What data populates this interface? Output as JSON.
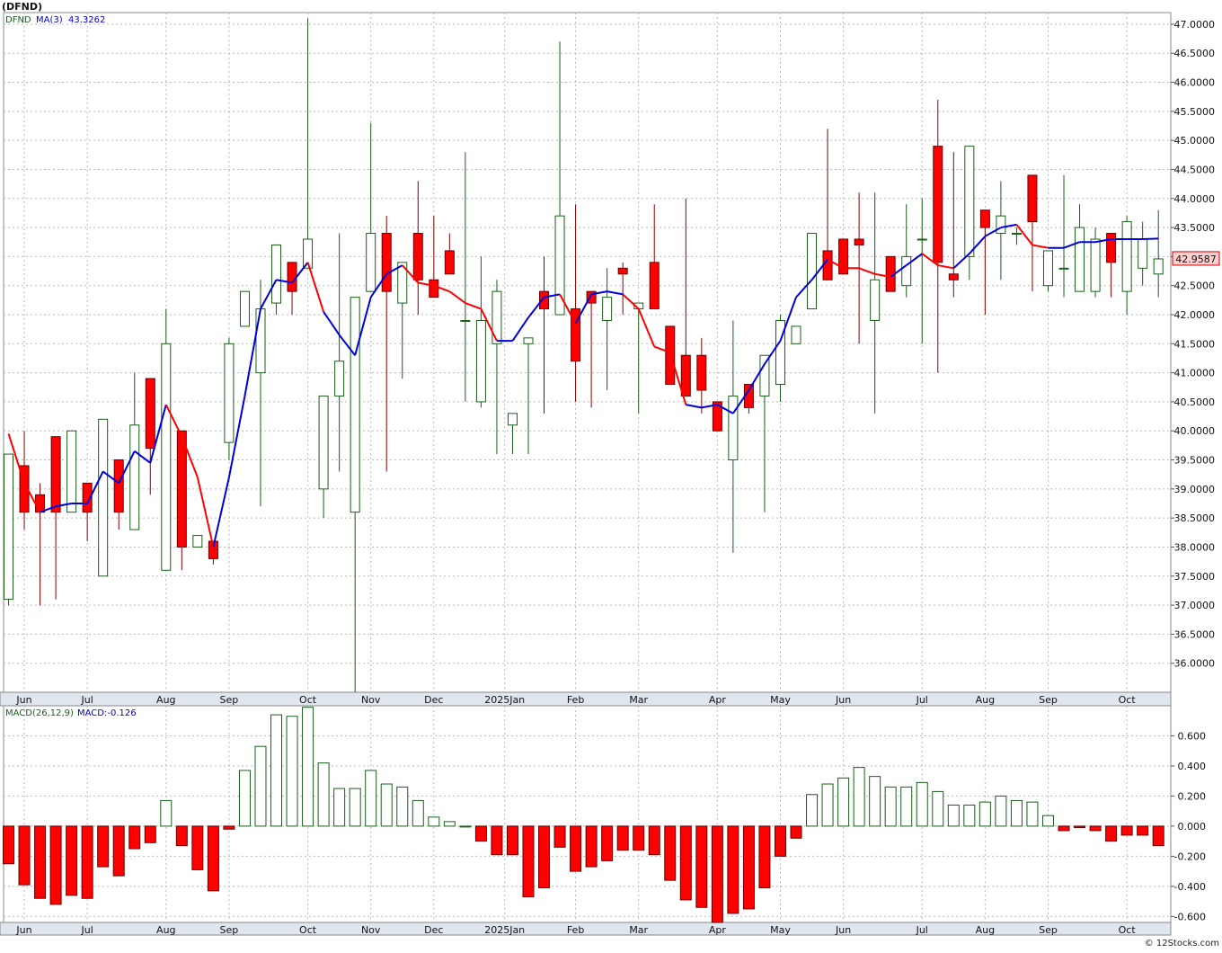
{
  "header": {
    "symbol_label": "(DFND)"
  },
  "watermark": "© 12Stocks.com",
  "colors": {
    "up": "#1a5e1a",
    "down": "#ff0000",
    "ma_up": "#0000dd",
    "ma_down": "#ff0000",
    "grid": "#bbbbbb",
    "axis_band": "#dfe6ee"
  },
  "chart_data": [
    {
      "type": "candlestick",
      "legend": {
        "ticker": "DFND",
        "ma_label": "MA(3)",
        "ma_value": "43.3262"
      },
      "last_price_label": "42.9587",
      "ylim": [
        35.5,
        47.2
      ],
      "y_ticks": [
        36.0,
        36.5,
        37.0,
        37.5,
        38.0,
        38.5,
        39.0,
        39.5,
        40.0,
        40.5,
        41.0,
        41.5,
        42.0,
        42.5,
        43.0,
        43.5,
        44.0,
        44.5,
        45.0,
        45.5,
        46.0,
        46.5,
        47.0
      ],
      "x_month_labels": [
        {
          "label": "Jun",
          "index": 1
        },
        {
          "label": "Jul",
          "index": 5
        },
        {
          "label": "Aug",
          "index": 10
        },
        {
          "label": "Sep",
          "index": 14
        },
        {
          "label": "Oct",
          "index": 19
        },
        {
          "label": "Nov",
          "index": 23
        },
        {
          "label": "Dec",
          "index": 27
        },
        {
          "label": "2025Jan",
          "index": 31.5
        },
        {
          "label": "Feb",
          "index": 36
        },
        {
          "label": "Mar",
          "index": 40
        },
        {
          "label": "Apr",
          "index": 45
        },
        {
          "label": "May",
          "index": 49
        },
        {
          "label": "Jun",
          "index": 53
        },
        {
          "label": "Jul",
          "index": 58
        },
        {
          "label": "Aug",
          "index": 62
        },
        {
          "label": "Sep",
          "index": 66
        },
        {
          "label": "Oct",
          "index": 71
        }
      ],
      "candles": [
        [
          37.1,
          39.6,
          37.0,
          39.4
        ],
        [
          39.4,
          38.6,
          40.0,
          38.3
        ],
        [
          38.9,
          38.6,
          39.1,
          37.0
        ],
        [
          39.9,
          38.6,
          39.9,
          37.1
        ],
        [
          38.6,
          40.0,
          40.0,
          38.6
        ],
        [
          39.1,
          38.6,
          39.1,
          38.1
        ],
        [
          37.5,
          40.2,
          40.2,
          37.5
        ],
        [
          39.5,
          38.6,
          39.5,
          38.3
        ],
        [
          38.3,
          40.1,
          41.0,
          38.3
        ],
        [
          40.9,
          39.7,
          40.9,
          38.9
        ],
        [
          37.6,
          41.5,
          42.1,
          37.6
        ],
        [
          40.0,
          38.0,
          40.0,
          37.6
        ],
        [
          38.0,
          38.2,
          38.2,
          38.0
        ],
        [
          38.1,
          37.8,
          38.1,
          37.7
        ],
        [
          39.8,
          41.5,
          41.6,
          39.5
        ],
        [
          41.8,
          42.4,
          42.4,
          41.8
        ],
        [
          41.0,
          42.1,
          42.6,
          38.7
        ],
        [
          42.2,
          43.2,
          43.2,
          42.0
        ],
        [
          42.9,
          42.4,
          42.9,
          42.0
        ],
        [
          42.8,
          43.3,
          47.1,
          42.8
        ],
        [
          39.0,
          40.6,
          40.6,
          38.5
        ],
        [
          40.6,
          41.2,
          43.4,
          39.3
        ],
        [
          38.6,
          42.3,
          42.3,
          35.5
        ],
        [
          42.4,
          43.4,
          45.3,
          42.4
        ],
        [
          43.4,
          42.4,
          43.7,
          39.3
        ],
        [
          42.2,
          42.9,
          42.9,
          40.9
        ],
        [
          43.4,
          42.6,
          44.3,
          42.0
        ],
        [
          42.6,
          42.3,
          43.7,
          42.3
        ],
        [
          43.1,
          42.7,
          43.4,
          42.7
        ],
        [
          41.9,
          41.9,
          44.8,
          40.5
        ],
        [
          40.5,
          41.9,
          43.0,
          40.4
        ],
        [
          41.5,
          42.4,
          42.6,
          39.6
        ],
        [
          40.1,
          40.3,
          40.3,
          39.6
        ],
        [
          41.5,
          41.6,
          41.6,
          39.6
        ],
        [
          42.4,
          42.1,
          43.0,
          40.3
        ],
        [
          42.0,
          43.7,
          46.7,
          42.0
        ],
        [
          42.1,
          41.2,
          43.9,
          40.5
        ],
        [
          42.4,
          42.2,
          42.4,
          40.4
        ],
        [
          41.9,
          42.3,
          42.8,
          40.7
        ],
        [
          42.8,
          42.7,
          42.9,
          42.0
        ],
        [
          42.1,
          42.2,
          42.2,
          40.3
        ],
        [
          42.9,
          42.1,
          43.9,
          42.1
        ],
        [
          41.8,
          40.8,
          41.8,
          40.8
        ],
        [
          41.3,
          40.6,
          44.0,
          40.6
        ],
        [
          41.3,
          40.7,
          41.6,
          40.3
        ],
        [
          40.5,
          40.0,
          40.5,
          40.0
        ],
        [
          39.5,
          40.6,
          41.9,
          37.9
        ],
        [
          40.8,
          40.4,
          40.8,
          40.3
        ],
        [
          40.6,
          41.3,
          41.3,
          38.6
        ],
        [
          40.8,
          41.9,
          42.0,
          40.5
        ],
        [
          41.5,
          41.8,
          41.8,
          41.5
        ],
        [
          42.1,
          43.4,
          43.4,
          42.1
        ],
        [
          43.1,
          42.6,
          45.2,
          42.6
        ],
        [
          43.3,
          42.7,
          43.3,
          42.7
        ],
        [
          43.3,
          43.2,
          44.1,
          41.5
        ],
        [
          41.9,
          42.6,
          44.1,
          40.3
        ],
        [
          43.0,
          42.4,
          43.0,
          42.4
        ],
        [
          42.5,
          43.0,
          43.9,
          42.3
        ],
        [
          43.3,
          43.3,
          44.0,
          41.5
        ],
        [
          44.9,
          42.9,
          45.7,
          41.0
        ],
        [
          42.7,
          42.6,
          44.8,
          42.3
        ],
        [
          43.0,
          44.9,
          44.9,
          42.6
        ],
        [
          43.8,
          43.5,
          43.8,
          42.0
        ],
        [
          43.4,
          43.7,
          44.3,
          42.6
        ],
        [
          43.4,
          43.4,
          43.5,
          43.2
        ],
        [
          44.4,
          43.6,
          44.4,
          42.4
        ],
        [
          42.5,
          43.1,
          43.1,
          42.4
        ],
        [
          42.8,
          42.8,
          44.4,
          42.3
        ],
        [
          42.4,
          43.5,
          43.9,
          42.4
        ],
        [
          42.4,
          43.3,
          43.5,
          42.3
        ],
        [
          43.4,
          42.9,
          43.4,
          42.3
        ],
        [
          42.4,
          43.6,
          43.7,
          42.0
        ],
        [
          42.8,
          43.3,
          43.6,
          42.5
        ],
        [
          42.7,
          42.96,
          43.8,
          42.3
        ]
      ],
      "ma3": [
        39.95,
        39.1,
        38.6,
        38.7,
        38.75,
        38.75,
        39.3,
        39.1,
        39.65,
        39.45,
        40.45,
        39.9,
        39.2,
        38.0,
        39.2,
        40.6,
        42.1,
        42.6,
        42.55,
        42.9,
        42.05,
        41.65,
        41.3,
        42.3,
        42.7,
        42.85,
        42.55,
        42.5,
        42.4,
        42.2,
        42.1,
        41.55,
        41.55,
        41.95,
        42.3,
        42.35,
        41.85,
        42.35,
        42.4,
        42.35,
        42.1,
        41.45,
        41.35,
        40.45,
        40.4,
        40.45,
        40.3,
        40.7,
        41.15,
        41.55,
        42.3,
        42.6,
        42.95,
        42.8,
        42.8,
        42.7,
        42.65,
        42.85,
        43.05,
        42.85,
        42.8,
        43.05,
        43.35,
        43.5,
        43.55,
        43.2,
        43.15,
        43.15,
        43.25,
        43.25,
        43.3,
        43.3,
        43.3,
        43.31
      ],
      "ma_trend": [
        "d",
        "d",
        "d",
        "u",
        "u",
        "u",
        "u",
        "u",
        "u",
        "u",
        "u",
        "d",
        "d",
        "d",
        "u",
        "u",
        "u",
        "u",
        "u",
        "u",
        "d",
        "u",
        "u",
        "u",
        "u",
        "u",
        "d",
        "d",
        "d",
        "d",
        "d",
        "d",
        "u",
        "u",
        "u",
        "u",
        "d",
        "u",
        "u",
        "u",
        "d",
        "d",
        "d",
        "d",
        "u",
        "u",
        "u",
        "u",
        "u",
        "u",
        "u",
        "u",
        "u",
        "d",
        "d",
        "d",
        "d",
        "u",
        "u",
        "d",
        "d",
        "u",
        "u",
        "u",
        "u",
        "d",
        "d",
        "u",
        "u",
        "u",
        "u",
        "u",
        "u",
        "u"
      ]
    },
    {
      "type": "bar",
      "legend": {
        "name": "MACD(26,12,9)",
        "value_label": "MACD:-0.126"
      },
      "ylim": [
        -0.64,
        0.8
      ],
      "y_ticks": [
        -0.6,
        -0.4,
        -0.2,
        0.0,
        0.2,
        0.4,
        0.6
      ],
      "values": [
        -0.25,
        -0.39,
        -0.48,
        -0.52,
        -0.46,
        -0.48,
        -0.27,
        -0.33,
        -0.15,
        -0.11,
        0.17,
        -0.13,
        -0.29,
        -0.43,
        -0.02,
        0.37,
        0.53,
        0.74,
        0.73,
        0.79,
        0.42,
        0.25,
        0.25,
        0.37,
        0.28,
        0.26,
        0.17,
        0.06,
        0.03,
        0.0,
        -0.1,
        -0.19,
        -0.19,
        -0.47,
        -0.41,
        -0.14,
        -0.3,
        -0.27,
        -0.23,
        -0.16,
        -0.16,
        -0.19,
        -0.36,
        -0.49,
        -0.54,
        -0.64,
        -0.58,
        -0.55,
        -0.41,
        -0.2,
        -0.08,
        0.21,
        0.28,
        0.32,
        0.39,
        0.33,
        0.26,
        0.26,
        0.29,
        0.23,
        0.14,
        0.14,
        0.16,
        0.2,
        0.17,
        0.16,
        0.07,
        -0.03,
        -0.01,
        -0.03,
        -0.1,
        -0.06,
        -0.06,
        -0.13
      ]
    }
  ]
}
